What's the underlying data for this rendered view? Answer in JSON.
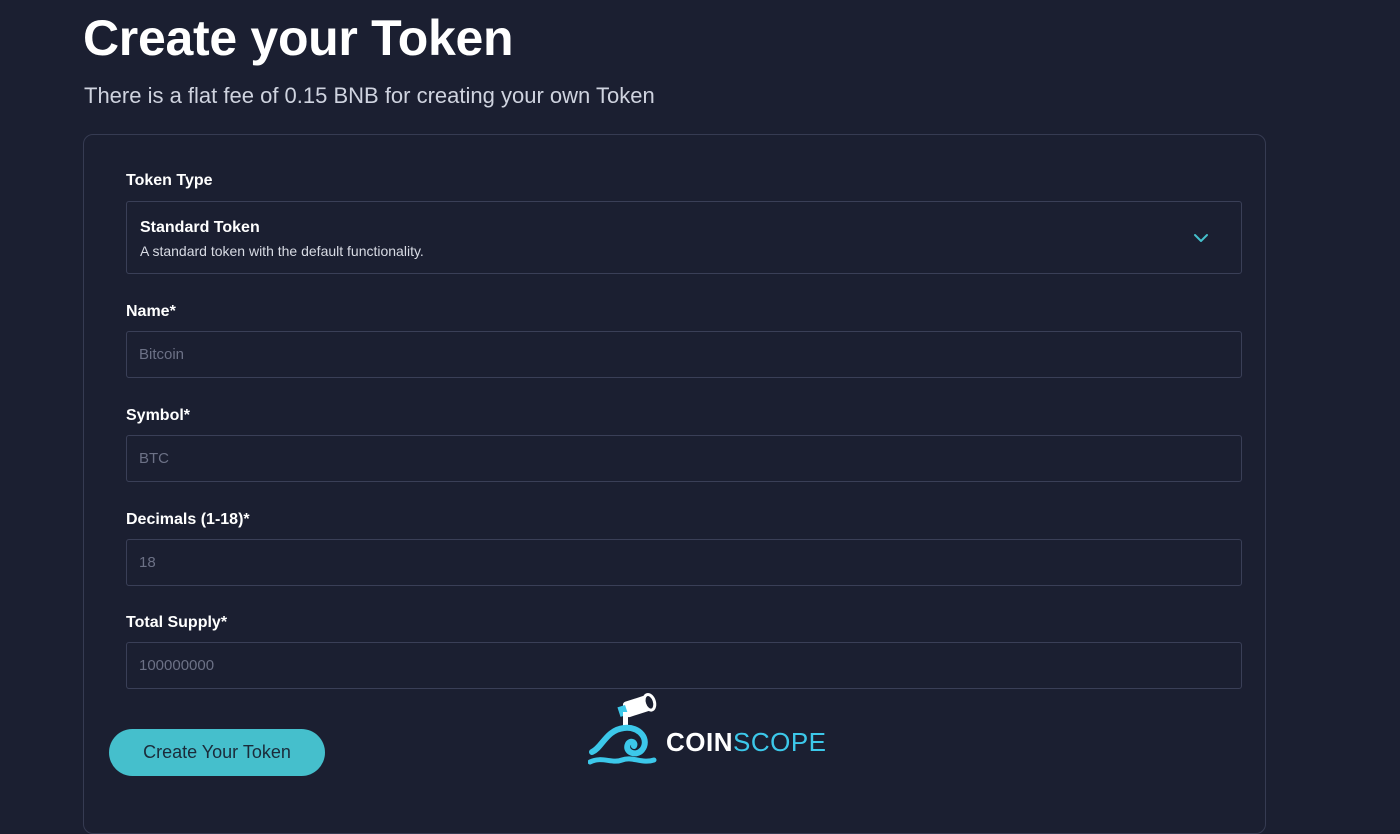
{
  "header": {
    "title": "Create your Token",
    "subtitle": "There is a flat fee of 0.15 BNB for creating your own Token"
  },
  "form": {
    "token_type": {
      "label": "Token Type",
      "selected_title": "Standard Token",
      "selected_description": "A standard token with the default functionality."
    },
    "name": {
      "label": "Name*",
      "placeholder": "Bitcoin"
    },
    "symbol": {
      "label": "Symbol*",
      "placeholder": "BTC"
    },
    "decimals": {
      "label": "Decimals (1-18)*",
      "placeholder": "18"
    },
    "total_supply": {
      "label": "Total Supply*",
      "placeholder": "100000000"
    },
    "submit_label": "Create Your Token"
  },
  "watermark": {
    "brand_bold": "COIN",
    "brand_light": "SCOPE"
  },
  "colors": {
    "background": "#1b1f31",
    "border": "#3a3f57",
    "accent": "#45bfcc",
    "brand_blue": "#3cc8ea"
  }
}
